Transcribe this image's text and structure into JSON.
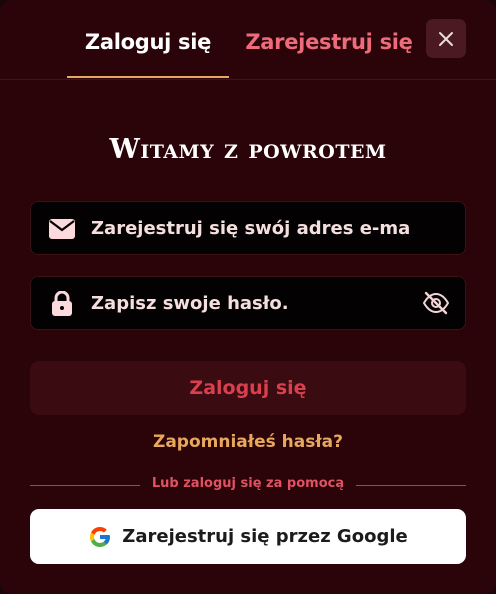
{
  "tabs": {
    "login": "Zaloguj się",
    "register": "Zarejestruj się"
  },
  "heading": "Witamy z powrotem",
  "email_field": {
    "placeholder": "Zarejestruj się swój adres e-mail",
    "icon": "envelope-icon"
  },
  "password_field": {
    "placeholder": "Zapisz swoje hasło.",
    "icon": "lock-icon",
    "toggle_icon": "eye-off-icon"
  },
  "login_button": "Zaloguj się",
  "forgot_link": "Zapomniałeś hasła?",
  "divider_text": "Lub zaloguj się za pomocą",
  "google_button": "Zarejestruj się przez Google",
  "colors": {
    "background": "#2a0409",
    "accent_gold": "#e8a85c",
    "accent_red": "#d8404e",
    "tab_inactive": "#ee6b7a"
  }
}
